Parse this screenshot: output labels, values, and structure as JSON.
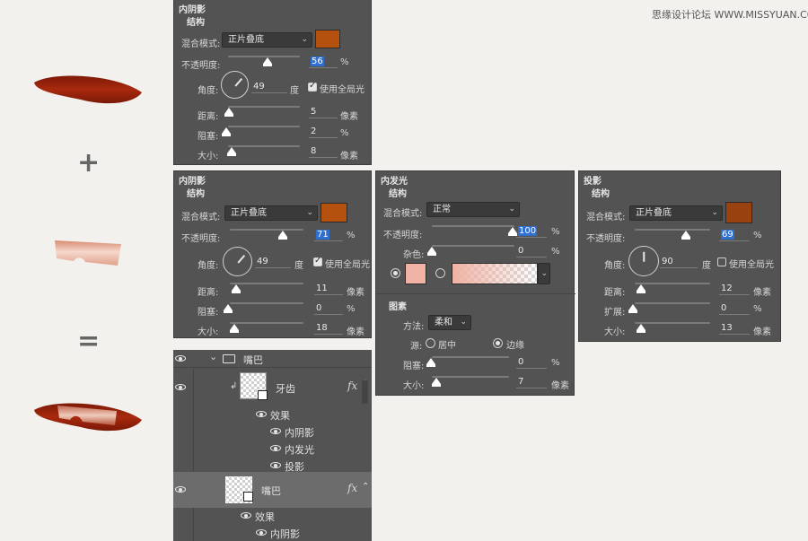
{
  "watermark": "思缘设计论坛 WWW.MISSYUAN.COM",
  "operators": {
    "plus": "+",
    "equals": "="
  },
  "colors": {
    "lip": "#a8290e",
    "shadow_color": "#b5510f",
    "glow_color": "#f0b2a4",
    "panel": "#535353"
  },
  "panel1": {
    "title": "内阴影",
    "structure": "结构",
    "blend_label": "混合模式:",
    "blend_value": "正片叠底",
    "opacity_label": "不透明度:",
    "opacity_value": "56",
    "opacity_unit": "%",
    "angle_label": "角度:",
    "angle_value": "49",
    "angle_unit": "度",
    "global_light": "使用全局光",
    "distance_label": "距离:",
    "distance_value": "5",
    "distance_unit": "像素",
    "choke_label": "阻塞:",
    "choke_value": "2",
    "choke_unit": "%",
    "size_label": "大小:",
    "size_value": "8",
    "size_unit": "像素"
  },
  "panel2": {
    "title": "内阴影",
    "structure": "结构",
    "blend_label": "混合模式:",
    "blend_value": "正片叠底",
    "opacity_label": "不透明度:",
    "opacity_value": "71",
    "opacity_unit": "%",
    "angle_label": "角度:",
    "angle_value": "49",
    "angle_unit": "度",
    "global_light": "使用全局光",
    "distance_label": "距离:",
    "distance_value": "11",
    "distance_unit": "像素",
    "choke_label": "阻塞:",
    "choke_value": "0",
    "choke_unit": "%",
    "size_label": "大小:",
    "size_value": "18",
    "size_unit": "像素"
  },
  "panel3": {
    "title": "内发光",
    "structure": "结构",
    "blend_label": "混合模式:",
    "blend_value": "正常",
    "opacity_label": "不透明度:",
    "opacity_value": "100",
    "opacity_unit": "%",
    "noise_label": "杂色:",
    "noise_value": "0",
    "noise_unit": "%",
    "elements": "图素",
    "method_label": "方法:",
    "method_value": "柔和",
    "source_label": "源:",
    "source_center": "居中",
    "source_edge": "边缘",
    "choke_label": "阻塞:",
    "choke_value": "0",
    "choke_unit": "%",
    "size_label": "大小:",
    "size_value": "7",
    "size_unit": "像素"
  },
  "panel4": {
    "title": "投影",
    "structure": "结构",
    "blend_label": "混合模式:",
    "blend_value": "正片叠底",
    "opacity_label": "不透明度:",
    "opacity_value": "69",
    "opacity_unit": "%",
    "angle_label": "角度:",
    "angle_value": "90",
    "angle_unit": "度",
    "global_light": "使用全局光",
    "distance_label": "距离:",
    "distance_value": "12",
    "distance_unit": "像素",
    "spread_label": "扩展:",
    "spread_value": "0",
    "spread_unit": "%",
    "size_label": "大小:",
    "size_value": "13",
    "size_unit": "像素"
  },
  "layers": {
    "group": "嘴巴",
    "teeth": "牙齿",
    "teeth_effects": "效果",
    "teeth_fx": [
      "内阴影",
      "内发光",
      "投影"
    ],
    "mouth": "嘴巴",
    "mouth_effects": "效果",
    "mouth_fx": [
      "内阴影"
    ],
    "fx_icon": "fx"
  }
}
